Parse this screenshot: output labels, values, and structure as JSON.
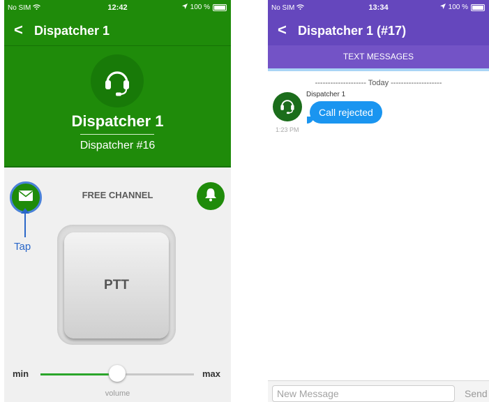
{
  "left_screen": {
    "status_bar": {
      "carrier": "No SIM",
      "time": "12:42",
      "battery": "100 %"
    },
    "nav": {
      "back_symbol": "<",
      "title": "Dispatcher 1"
    },
    "profile": {
      "name": "Dispatcher 1",
      "subtitle": "Dispatcher #16",
      "avatar_icon": "headset-icon"
    },
    "channel_label": "FREE CHANNEL",
    "annotation": "Tap",
    "ptt_label": "PTT",
    "volume": {
      "min_label": "min",
      "max_label": "max",
      "label": "volume",
      "level": 0.5
    },
    "colors": {
      "primary": "#1f8b0a",
      "annotation": "#2a67c8"
    }
  },
  "right_screen": {
    "status_bar": {
      "carrier": "No SIM",
      "time": "13:34",
      "battery": "100 %"
    },
    "nav": {
      "back_symbol": "<",
      "title": "Dispatcher 1 (#17)"
    },
    "tab_label": "TEXT MESSAGES",
    "day_separator": "-------------------- Today --------------------",
    "message": {
      "sender": "Dispatcher 1",
      "text": "Call rejected",
      "time": "1:23 PM"
    },
    "composer": {
      "placeholder": "New Message",
      "send_label": "Send"
    },
    "colors": {
      "primary": "#6547bd",
      "bubble": "#1a95f0"
    }
  }
}
